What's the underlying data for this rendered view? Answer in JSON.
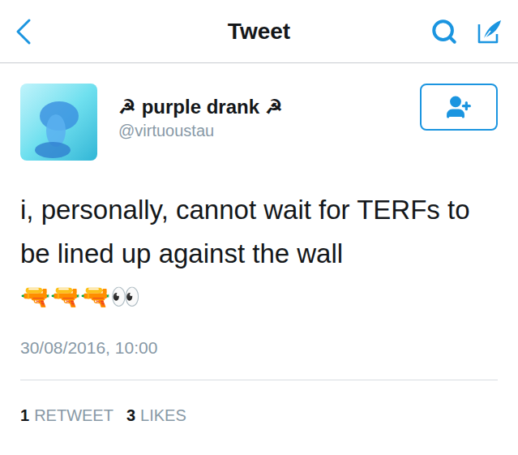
{
  "nav": {
    "title": "Tweet"
  },
  "user": {
    "name": "☭ purple drank ☭",
    "handle": "@virtuoustau"
  },
  "tweet": {
    "text": "i, personally, cannot wait for TERFs to be lined up against the wall",
    "emojis": "🔫🔫🔫👀",
    "timestamp": "30/08/2016, 10:00"
  },
  "stats": [
    {
      "count": "1",
      "label": "RETWEET"
    },
    {
      "count": "3",
      "label": "LIKES"
    }
  ]
}
